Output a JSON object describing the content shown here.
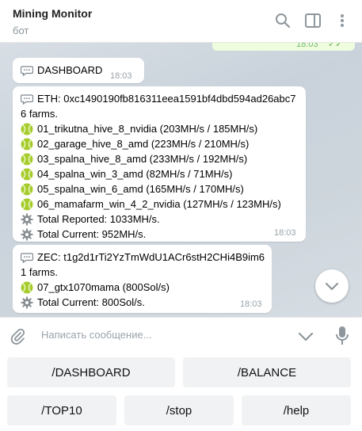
{
  "header": {
    "title": "Mining Monitor",
    "subtitle": "бот"
  },
  "previous_message": {
    "time": "18:03",
    "status": "✓✓"
  },
  "messages": [
    {
      "lines": [
        "DASHBOARD"
      ],
      "time": "18:03"
    },
    {
      "lines": [
        "ETH: 0xc1490190fb816311eea1591bf4dbd594ad26abc7",
        "6 farms.",
        "01_trikutna_hive_8_nvidia (203MH/s / 185MH/s)",
        "02_garage_hive_8_amd (223MH/s / 210MH/s)",
        "03_spalna_hive_8_amd (233MH/s / 192MH/s)",
        "04_spalna_win_3_amd (82MH/s / 71MH/s)",
        "05_spalna_win_6_amd (165MH/s / 170MH/s)",
        "06_mamafarm_win_4_2_nvidia (127MH/s / 123MH/s)",
        "Total Reported: 1033MH/s.",
        "Total Current: 952MH/s."
      ],
      "time": "18:03"
    },
    {
      "lines": [
        "ZEC: t1g2d1rTi2YzTmWdU1ACr6stH2CHi4B9im6",
        "1 farms.",
        "07_gtx1070mama (800Sol/s)",
        "Total Current: 800Sol/s."
      ],
      "time": "18:03"
    }
  ],
  "input": {
    "placeholder": "Написать сообщение..."
  },
  "keyboard": {
    "row1": [
      "/DASHBOARD",
      "/BALANCE"
    ],
    "row2": [
      "/TOP10",
      "/stop",
      "/help"
    ]
  },
  "colors": {
    "accent": "#8d969c",
    "bubble": "#ffffff",
    "outgoing_bubble": "#effdde",
    "key_bg": "#f0f2f4"
  }
}
